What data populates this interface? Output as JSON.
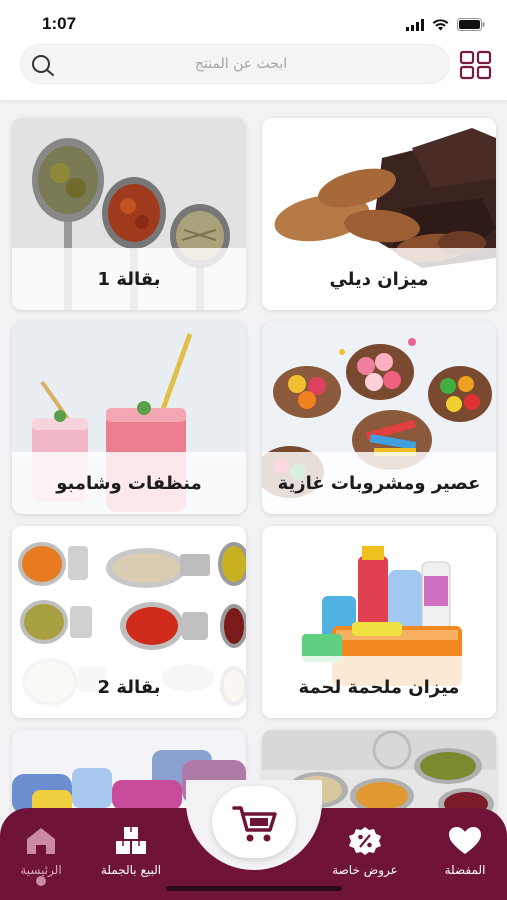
{
  "status_bar": {
    "time": "1:07"
  },
  "search": {
    "placeholder": "ابحث عن المنتج"
  },
  "categories": [
    {
      "label": "ميزان ديلي",
      "image": "nuts-chocolate"
    },
    {
      "label": "بقالة 1",
      "image": "spice-spoons"
    },
    {
      "label": "عصير ومشروبات غازية",
      "image": "candy-bowls"
    },
    {
      "label": "منظفات وشامبو",
      "image": "smoothie-jars"
    },
    {
      "label": "ميزان ملحمة لحمة",
      "image": "cleaning-supplies"
    },
    {
      "label": "بقالة 2",
      "image": "canned-food"
    },
    {
      "label": "",
      "image": "grains-bowls"
    },
    {
      "label": "",
      "image": "towels"
    }
  ],
  "bottom_nav": {
    "favorites": "المفضلة",
    "offers": "عروض خاصة",
    "wholesale": "البيع بالجملة",
    "home": "الرئيسية"
  },
  "colors": {
    "brand": "#6f1438",
    "active_nav": "#d9a9bb",
    "background": "#f2f2f4"
  }
}
